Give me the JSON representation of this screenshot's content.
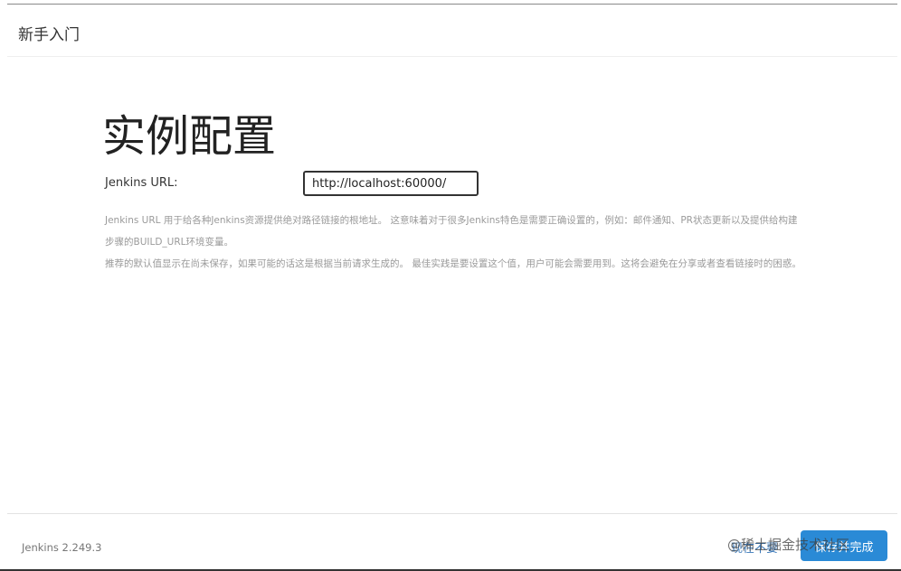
{
  "header": {
    "title": "新手入门"
  },
  "main": {
    "heading": "实例配置",
    "url_label": "Jenkins URL:",
    "url_value": "http://localhost:60000/",
    "help_line_1": "Jenkins URL 用于给各种Jenkins资源提供绝对路径链接的根地址。 这意味着对于很多Jenkins特色是需要正确设置的，例如：邮件通知、PR状态更新以及提供给构建步骤的BUILD_URL环境变量。",
    "help_line_2": "推荐的默认值显示在尚未保存，如果可能的话这是根据当前请求生成的。 最佳实践是要设置这个值，用户可能会需要用到。这将会避免在分享或者查看链接时的困惑。"
  },
  "footer": {
    "version": "Jenkins 2.249.3",
    "later_label": "现在不要",
    "save_label": "保存并完成"
  },
  "watermark": "@稀土掘金技术社区",
  "colors": {
    "accent": "#2a8ad6",
    "link": "#3a78b9",
    "help_text": "#9a9a9a"
  }
}
